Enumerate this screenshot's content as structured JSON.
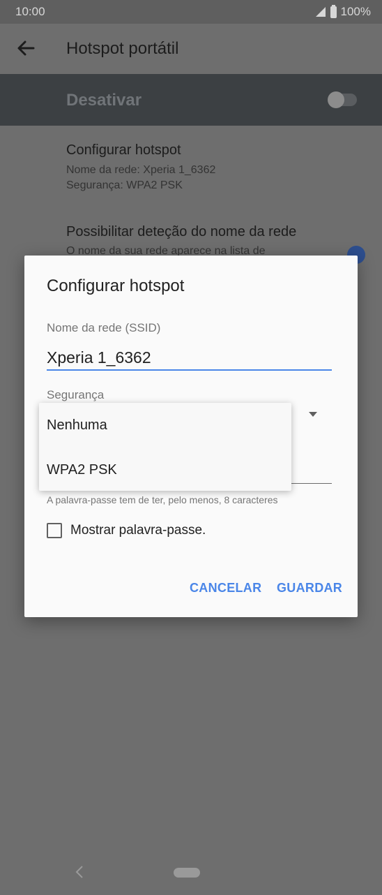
{
  "status_bar": {
    "time": "10:00",
    "battery_percent": "100%",
    "icons": [
      "signal-icon",
      "battery-icon"
    ]
  },
  "app_bar": {
    "title": "Hotspot portátil",
    "back_icon": "back-arrow-icon"
  },
  "main_toggle": {
    "label": "Desativar",
    "state": "off"
  },
  "settings": [
    {
      "title": "Configurar hotspot",
      "lines": [
        "Nome da rede: Xperia 1_6362",
        "Segurança: WPA2 PSK"
      ]
    },
    {
      "title": "Possibilitar deteção do nome da rede",
      "lines": [
        "O nome da sua rede aparece na lista de"
      ],
      "switch_state": "on"
    }
  ],
  "dialog": {
    "title": "Configurar hotspot",
    "ssid_label": "Nome da rede (SSID)",
    "ssid_value": "Xperia 1_6362",
    "security_label": "Segurança",
    "password_hint": "A palavra-passe tem de ter, pelo menos, 8 caracteres",
    "show_password_label": "Mostrar palavra-passe.",
    "show_password_checked": false,
    "cancel_label": "CANCELAR",
    "save_label": "GUARDAR"
  },
  "security_menu": {
    "options": [
      "Nenhuma",
      "WPA2 PSK"
    ]
  },
  "colors": {
    "accent": "#4a86e8",
    "scrim_background": "#6e6e6e",
    "dialog_background": "#fafafa"
  }
}
